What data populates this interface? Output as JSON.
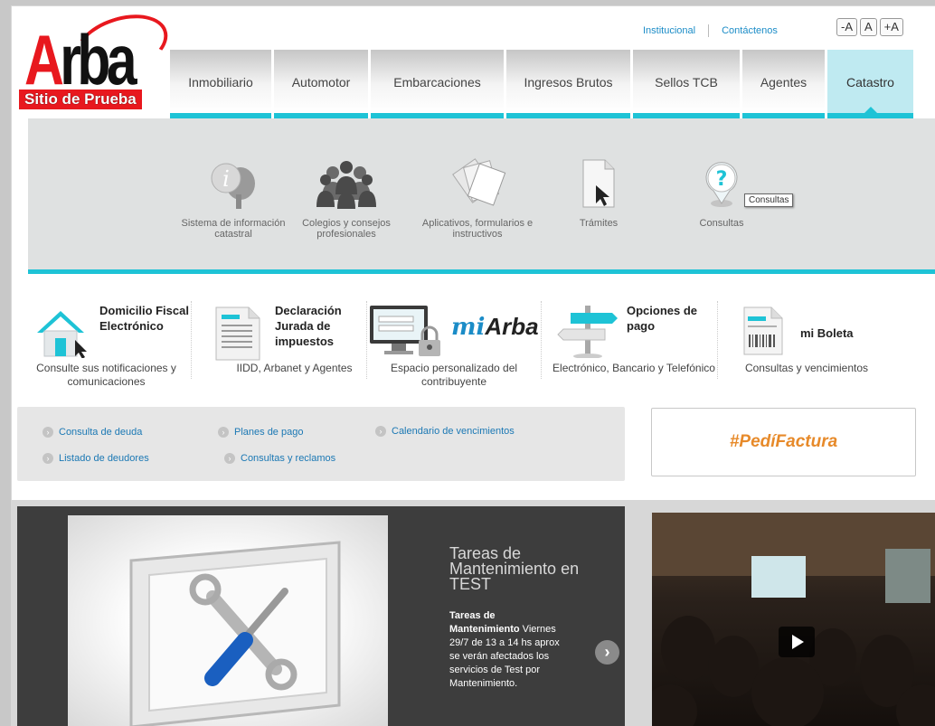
{
  "logo": {
    "brand": "Arba",
    "subtitle": "Sitio de Prueba"
  },
  "top_links": [
    "Institucional",
    "Contáctenos"
  ],
  "font_size_controls": [
    "-A",
    "A",
    "+A"
  ],
  "nav": {
    "tabs": [
      {
        "label": "Inmobiliario"
      },
      {
        "label": "Automotor"
      },
      {
        "label": "Embarcaciones"
      },
      {
        "label": "Ingresos Brutos"
      },
      {
        "label": "Sellos  TCB"
      },
      {
        "label": "Agentes"
      },
      {
        "label": "Catastro",
        "active": true
      }
    ]
  },
  "catastro_panel": {
    "items": [
      {
        "label": "Sistema de información catastral",
        "icon": "info-tree-icon"
      },
      {
        "label": "Colegios y consejos profesionales",
        "icon": "people-group-icon"
      },
      {
        "label": "Aplicativos, formularios e instructivos",
        "icon": "documents-icon"
      },
      {
        "label": "Trámites",
        "icon": "document-cursor-icon"
      },
      {
        "label": "Consultas",
        "icon": "question-pin-icon"
      }
    ],
    "tooltip": "Consultas"
  },
  "services": [
    {
      "title": "Domicilio Fiscal Electrónico",
      "desc": "Consulte sus notificaciones y comunicaciones",
      "icon": "house-icon"
    },
    {
      "title": "Declaración Jurada de impuestos",
      "desc": "IIDD, Arbanet y Agentes",
      "icon": "form-document-icon"
    },
    {
      "title": "miArba",
      "title_mi": "mi",
      "title_arba": "Arba",
      "desc": "Espacio personalizado del contribuyente",
      "icon": "monitor-lock-icon"
    },
    {
      "title": "Opciones de pago",
      "desc": "Electrónico, Bancario y Telefónico",
      "icon": "signpost-icon"
    },
    {
      "title": "mi Boleta",
      "desc": "Consultas y vencimientos",
      "icon": "barcode-document-icon"
    }
  ],
  "quick_links": [
    "Consulta de deuda",
    "Planes de pago",
    "Calendario de vencimientos",
    "Listado de deudores",
    "Consultas y reclamos"
  ],
  "promo": "#PedíFactura",
  "slider": {
    "title": "Tareas de Mantenimiento en TEST",
    "body_bold": "Tareas de Mantenimiento",
    "body_text": " Viernes 29/7 de 13 a 14 hs aprox se verán afectados los servicios de Test por Mantenimiento.",
    "next": "›"
  },
  "colors": {
    "accent": "#1ec3d6",
    "link": "#1b78b4",
    "brand_red": "#e8181e",
    "promo": "#e78a2a"
  }
}
